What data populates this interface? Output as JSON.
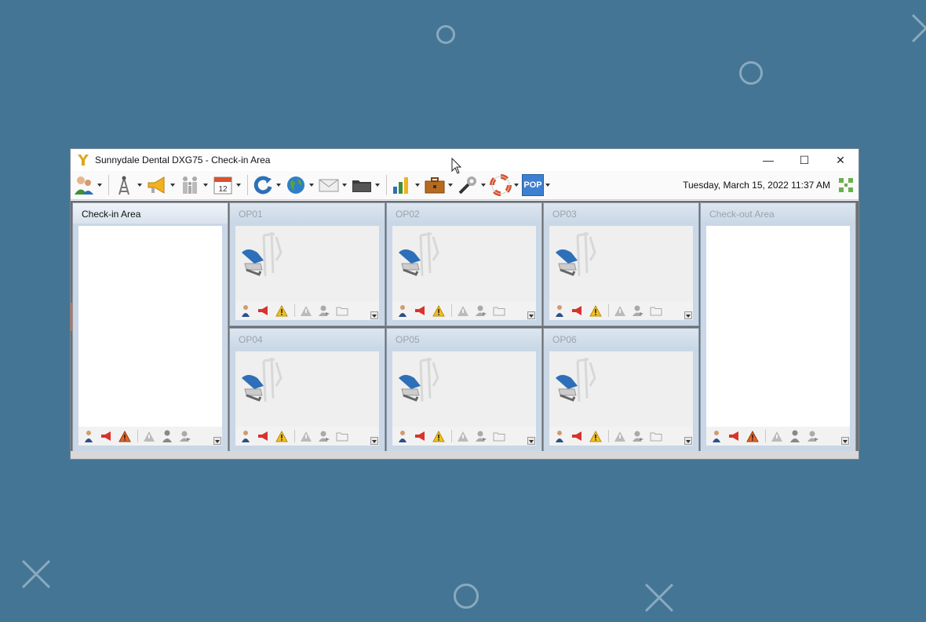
{
  "window": {
    "title": "Sunnydale Dental DXG75 - Check-in Area",
    "controls": {
      "minimize": "—",
      "maximize": "☐",
      "close": "✕"
    }
  },
  "toolbar": {
    "datetime": "Tuesday, March 15, 2022 11:37 AM",
    "buttons": [
      {
        "name": "patients",
        "icon": "users-icon"
      },
      {
        "name": "network",
        "icon": "antenna-icon"
      },
      {
        "name": "notify",
        "icon": "megaphone-icon"
      },
      {
        "name": "family",
        "icon": "family-icon"
      },
      {
        "name": "calendar",
        "icon": "calendar-icon",
        "text": "12"
      },
      {
        "name": "refresh",
        "icon": "refresh-icon"
      },
      {
        "name": "web",
        "icon": "globe-icon"
      },
      {
        "name": "mail",
        "icon": "mail-icon"
      },
      {
        "name": "folder",
        "icon": "folder-icon"
      },
      {
        "name": "reports",
        "icon": "chart-icon"
      },
      {
        "name": "office",
        "icon": "briefcase-icon"
      },
      {
        "name": "tools",
        "icon": "wrench-icon"
      },
      {
        "name": "help",
        "icon": "lifebuoy-icon"
      },
      {
        "name": "pop",
        "icon": "pop-icon",
        "text": "POP"
      }
    ]
  },
  "panels": {
    "checkin": {
      "title": "Check-in Area"
    },
    "checkout": {
      "title": "Check-out Area"
    },
    "ops": [
      {
        "title": "OP01"
      },
      {
        "title": "OP02"
      },
      {
        "title": "OP03"
      },
      {
        "title": "OP04"
      },
      {
        "title": "OP05"
      },
      {
        "title": "OP06"
      }
    ]
  },
  "colors": {
    "background": "#447594",
    "accent_blue": "#3d7fd0",
    "warning_yellow": "#f2c01e",
    "active_marker": "#e2662a"
  }
}
